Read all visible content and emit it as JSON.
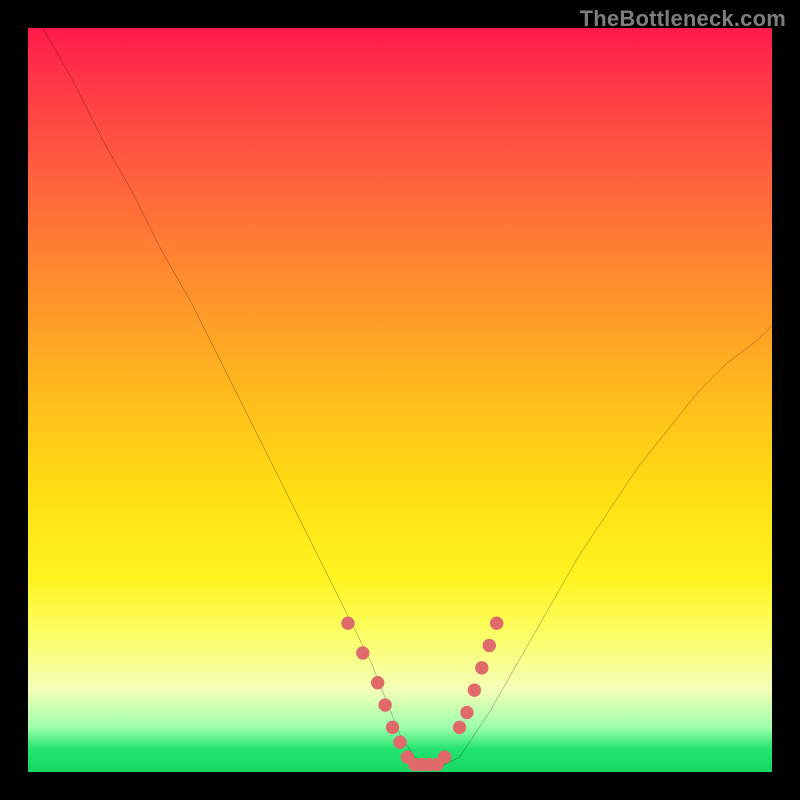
{
  "watermark": "TheBottleneck.com",
  "chart_data": {
    "type": "line",
    "title": "",
    "xlabel": "",
    "ylabel": "",
    "xlim": [
      0,
      100
    ],
    "ylim": [
      0,
      100
    ],
    "grid": false,
    "legend": false,
    "series": [
      {
        "name": "bottleneck-curve",
        "color": "#000000",
        "x": [
          2,
          6,
          10,
          14,
          18,
          22,
          26,
          30,
          34,
          38,
          42,
          46,
          48,
          50,
          52,
          54,
          56,
          58,
          62,
          66,
          70,
          74,
          78,
          82,
          86,
          90,
          94,
          98,
          100
        ],
        "values": [
          100,
          93,
          85,
          78,
          70,
          63,
          55,
          47,
          39,
          31,
          23,
          15,
          10,
          5,
          2,
          1,
          1,
          2,
          8,
          15,
          22,
          29,
          35,
          41,
          46,
          51,
          55,
          58,
          60
        ]
      }
    ],
    "markers": {
      "name": "highlight-dots",
      "color": "#e06a6a",
      "x": [
        43,
        45,
        47,
        48,
        49,
        50,
        51,
        52,
        53,
        54,
        55,
        56,
        58,
        59,
        60,
        61,
        62,
        63
      ],
      "values": [
        20,
        16,
        12,
        9,
        6,
        4,
        2,
        1,
        1,
        1,
        1,
        2,
        6,
        8,
        11,
        14,
        17,
        20
      ]
    }
  }
}
